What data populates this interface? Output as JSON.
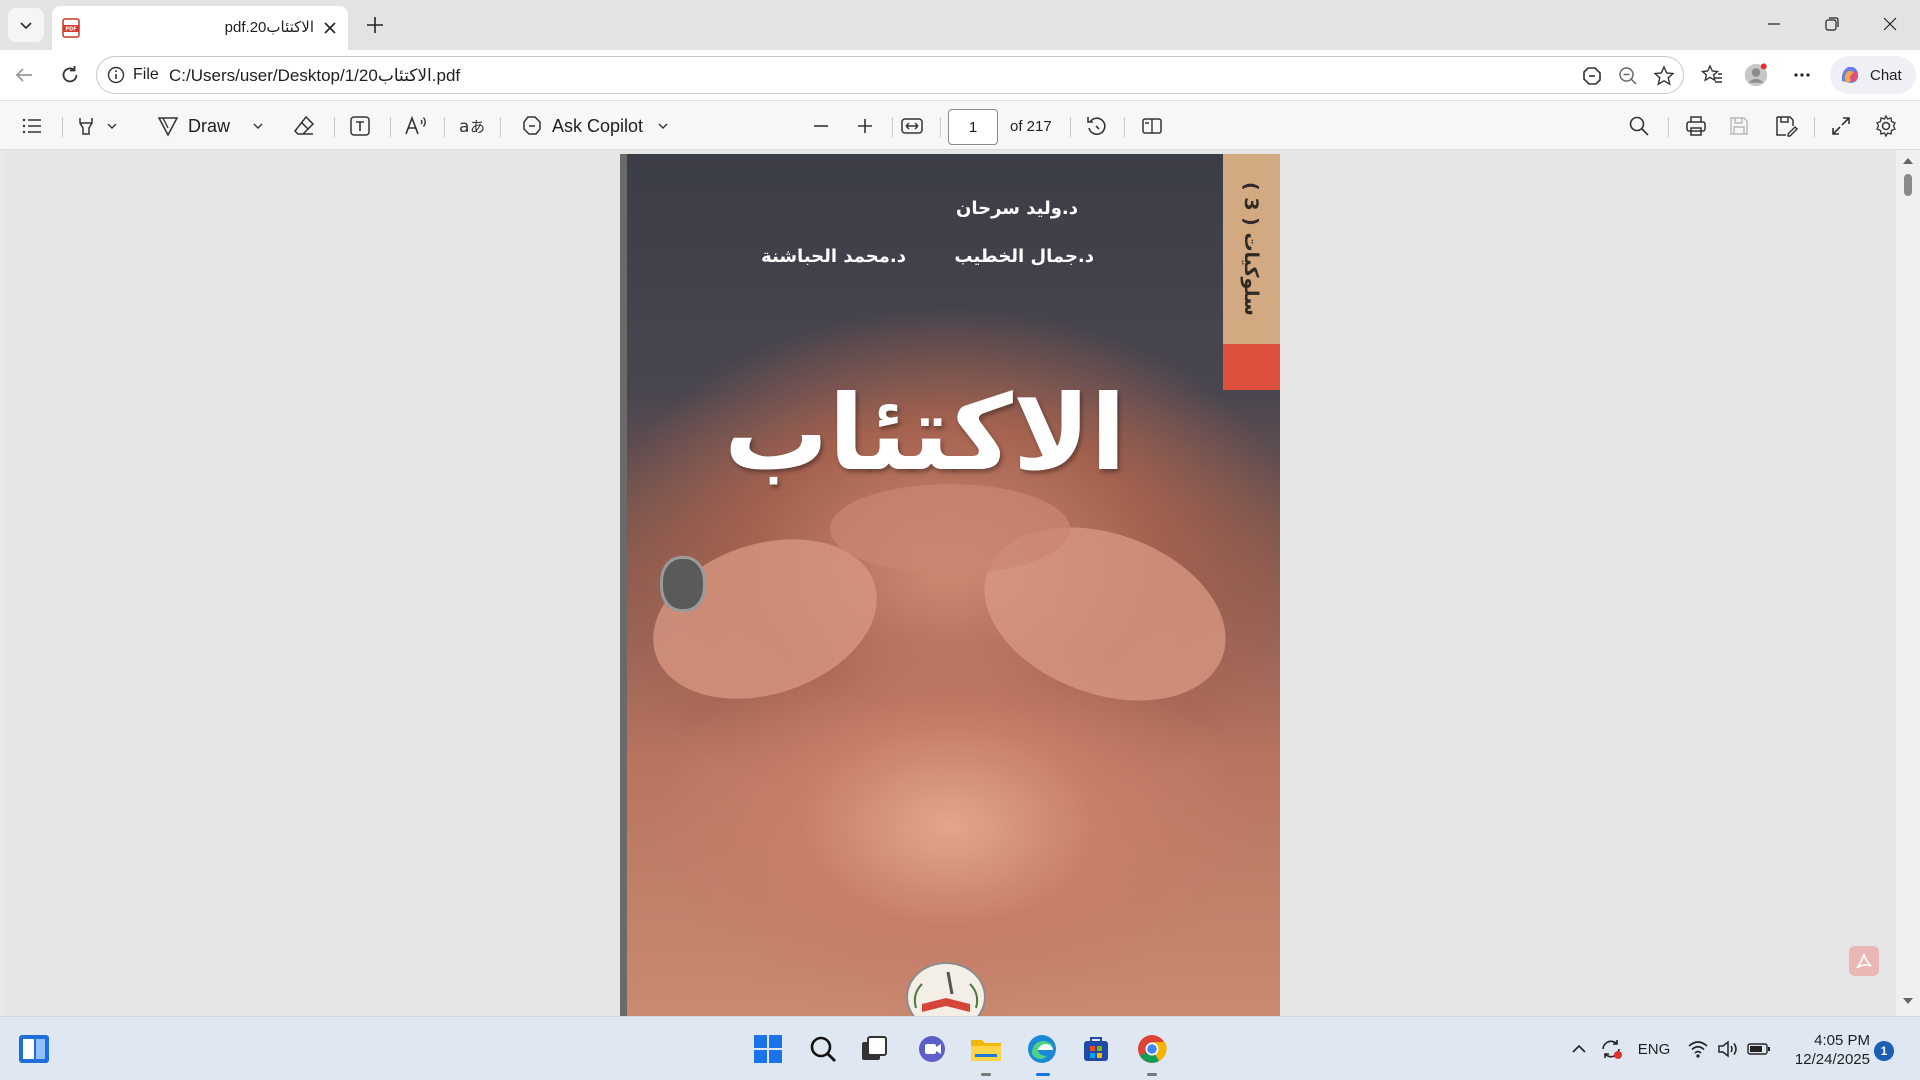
{
  "browser": {
    "tab": {
      "title": "الاكتئاب20.pdf",
      "favicon": "pdf-file-icon"
    },
    "window_controls": [
      "minimize-icon",
      "restore-icon",
      "close-icon"
    ],
    "address": {
      "scheme_label": "File",
      "url": "C:/Users/user/Desktop/1/20الاكتئاب.pdf"
    },
    "chat_label": "Chat"
  },
  "pdf_toolbar": {
    "draw_label": "Draw",
    "ask_copilot_label": "Ask Copilot",
    "current_page": "1",
    "page_total_label": "of 217"
  },
  "document": {
    "author_1": "د.وليد سرحان",
    "author_2": "د.جمال الخطيب",
    "author_3": "د.محمد الحباشنة",
    "title": "الاكتئاب",
    "series": "سلوكيات ( 3 )",
    "colors": {
      "spine": "#d2a980",
      "accent": "#e0503e"
    }
  },
  "taskbar": {
    "apps": [
      "windows-start-icon",
      "search-icon",
      "task-view-icon",
      "teams-icon",
      "file-explorer-icon",
      "edge-icon",
      "store-icon",
      "chrome-icon"
    ],
    "language": "ENG",
    "time": "4:05 PM",
    "date": "12/24/2025",
    "notification_count": "1"
  }
}
